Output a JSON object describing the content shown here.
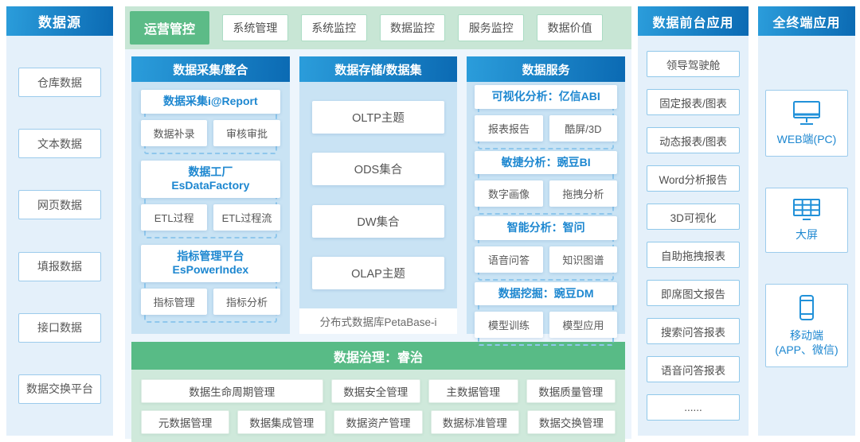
{
  "palette": {
    "header_blue_from": "#2b9ddb",
    "header_blue_to": "#0b6ab3",
    "panel_light_blue": "#e4f0fa",
    "column_blue_bg": "#c9e3f4",
    "accent_blue": "#1d87d0",
    "green_solid": "#5cbb87",
    "green_bar_bg": "#c8e6d5",
    "green_body_bg": "#cfe9db",
    "text_gray": "#575757"
  },
  "data_sources": {
    "title": "数据源",
    "items": [
      "仓库数据",
      "文本数据",
      "网页数据",
      "填报数据",
      "接口数据",
      "数据交换平台"
    ]
  },
  "ops": {
    "title": "运营管控",
    "buttons": [
      "系统管理",
      "系统监控",
      "数据监控",
      "服务监控",
      "数据价值"
    ]
  },
  "collect": {
    "title": "数据采集/整合",
    "groups": [
      {
        "title_line1": "数据采集i@Report",
        "title_line2": "",
        "items": [
          "数据补录",
          "审核审批"
        ]
      },
      {
        "title_line1": "数据工厂",
        "title_line2": "EsDataFactory",
        "items": [
          "ETL过程",
          "ETL过程流"
        ]
      },
      {
        "title_line1": "指标管理平台",
        "title_line2": "EsPowerIndex",
        "items": [
          "指标管理",
          "指标分析"
        ]
      }
    ]
  },
  "storage": {
    "title": "数据存储/数据集",
    "items": [
      "OLTP主题",
      "ODS集合",
      "DW集合",
      "OLAP主题"
    ],
    "footer": "分布式数据库PetaBase-i"
  },
  "services": {
    "title": "数据服务",
    "groups": [
      {
        "title": "可视化分析：亿信ABI",
        "items": [
          "报表报告",
          "酷屏/3D"
        ]
      },
      {
        "title": "敏捷分析：豌豆BI",
        "items": [
          "数字画像",
          "拖拽分析"
        ]
      },
      {
        "title": "智能分析：智问",
        "items": [
          "语音问答",
          "知识图谱"
        ]
      },
      {
        "title": "数据挖掘：豌豆DM",
        "items": [
          "模型训练",
          "模型应用"
        ]
      }
    ]
  },
  "governance": {
    "title": "数据治理：睿治",
    "row1": [
      "数据生命周期管理",
      "数据安全管理",
      "主数据管理",
      "数据质量管理"
    ],
    "row2": [
      "元数据管理",
      "数据集成管理",
      "数据资产管理",
      "数据标准管理",
      "数据交换管理"
    ]
  },
  "front_apps": {
    "title": "数据前台应用",
    "items": [
      "领导驾驶舱",
      "固定报表/图表",
      "动态报表/图表",
      "Word分析报告",
      "3D可视化",
      "自助拖拽报表",
      "即席图文报告",
      "搜索问答报表",
      "语音问答报表",
      "......"
    ]
  },
  "terminals": {
    "title": "全终端应用",
    "items": [
      {
        "icon": "monitor-icon",
        "label": "WEB端(PC)",
        "label2": ""
      },
      {
        "icon": "bigscreen-icon",
        "label": "大屏",
        "label2": ""
      },
      {
        "icon": "phone-icon",
        "label": "移动端",
        "label2": "(APP、微信)"
      }
    ]
  }
}
